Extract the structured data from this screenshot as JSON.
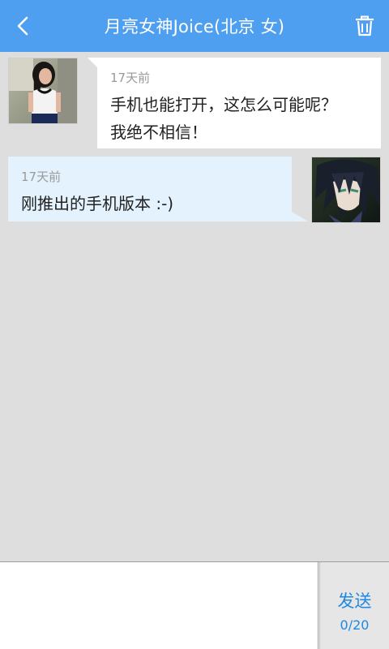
{
  "header": {
    "title": "月亮女神Joice(北京 女)",
    "back_icon": "chevron-left-icon",
    "trash_icon": "trash-icon",
    "bg_color": "#4f9ff0"
  },
  "messages": [
    {
      "direction": "incoming",
      "time": "17天前",
      "text_line1": "手机也能打开，这怎么可能呢？",
      "text_line2": "我绝不相信！"
    },
    {
      "direction": "outgoing",
      "time": "17天前",
      "text": "刚推出的手机版本 :-)"
    }
  ],
  "composer": {
    "input_value": "",
    "send_label": "发送",
    "char_count": "0/20"
  },
  "colors": {
    "accent": "#4f9ff0",
    "send_text": "#1e88e5",
    "background": "#dedede",
    "incoming_bubble": "#ffffff",
    "outgoing_bubble": "#e3f2fd"
  }
}
